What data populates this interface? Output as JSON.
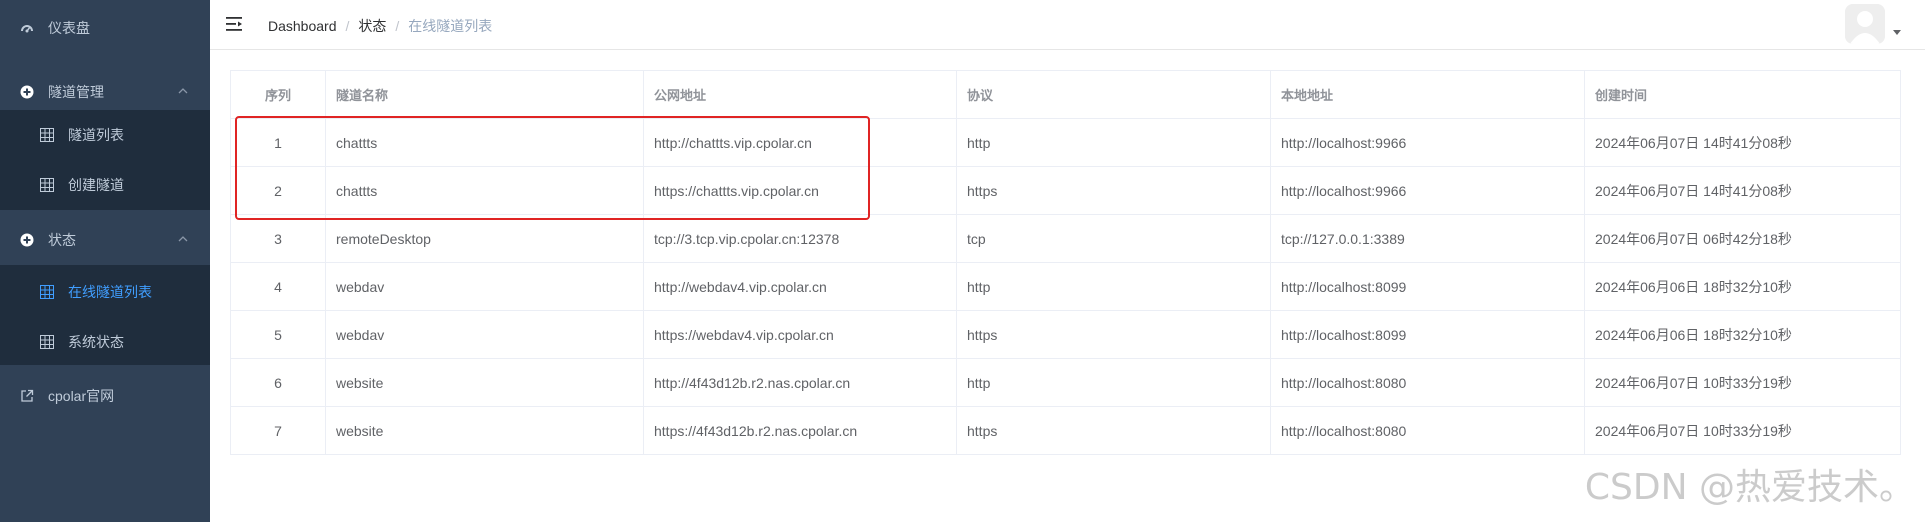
{
  "sidebar": {
    "dashboard_label": "仪表盘",
    "tunnel_mgmt_label": "隧道管理",
    "tunnel_list_label": "隧道列表",
    "create_tunnel_label": "创建隧道",
    "status_label": "状态",
    "online_tunnels_label": "在线隧道列表",
    "system_status_label": "系统状态",
    "official_site_label": "cpolar官网"
  },
  "breadcrumb": {
    "item1": "Dashboard",
    "item2": "状态",
    "item3": "在线隧道列表",
    "separator": "/"
  },
  "table": {
    "headers": {
      "index": "序列",
      "name": "隧道名称",
      "public_url": "公网地址",
      "protocol": "协议",
      "local_addr": "本地地址",
      "created": "创建时间"
    },
    "rows": [
      {
        "index": "1",
        "name": "chattts",
        "public_url": "http://chattts.vip.cpolar.cn",
        "protocol": "http",
        "local_addr": "http://localhost:9966",
        "created": "2024年06月07日 14时41分08秒"
      },
      {
        "index": "2",
        "name": "chattts",
        "public_url": "https://chattts.vip.cpolar.cn",
        "protocol": "https",
        "local_addr": "http://localhost:9966",
        "created": "2024年06月07日 14时41分08秒"
      },
      {
        "index": "3",
        "name": "remoteDesktop",
        "public_url": "tcp://3.tcp.vip.cpolar.cn:12378",
        "protocol": "tcp",
        "local_addr": "tcp://127.0.0.1:3389",
        "created": "2024年06月07日 06时42分18秒"
      },
      {
        "index": "4",
        "name": "webdav",
        "public_url": "http://webdav4.vip.cpolar.cn",
        "protocol": "http",
        "local_addr": "http://localhost:8099",
        "created": "2024年06月06日 18时32分10秒"
      },
      {
        "index": "5",
        "name": "webdav",
        "public_url": "https://webdav4.vip.cpolar.cn",
        "protocol": "https",
        "local_addr": "http://localhost:8099",
        "created": "2024年06月06日 18时32分10秒"
      },
      {
        "index": "6",
        "name": "website",
        "public_url": "http://4f43d12b.r2.nas.cpolar.cn",
        "protocol": "http",
        "local_addr": "http://localhost:8080",
        "created": "2024年06月07日 10时33分19秒"
      },
      {
        "index": "7",
        "name": "website",
        "public_url": "https://4f43d12b.r2.nas.cpolar.cn",
        "protocol": "https",
        "local_addr": "http://localhost:8080",
        "created": "2024年06月07日 10时33分19秒"
      }
    ]
  },
  "watermark": "CSDN @热爱技术。",
  "icons": {
    "dashboard": "dashboard-icon",
    "tunnel_mgmt": "plus-circle-icon",
    "table": "grid-icon",
    "external": "external-link-icon",
    "menu": "menu-fold-icon",
    "chevron": "chevron-up-icon"
  },
  "colors": {
    "sidebar_bg": "#304156",
    "submenu_bg": "#1f2d3d",
    "active": "#409eff",
    "highlight": "#e02424"
  }
}
